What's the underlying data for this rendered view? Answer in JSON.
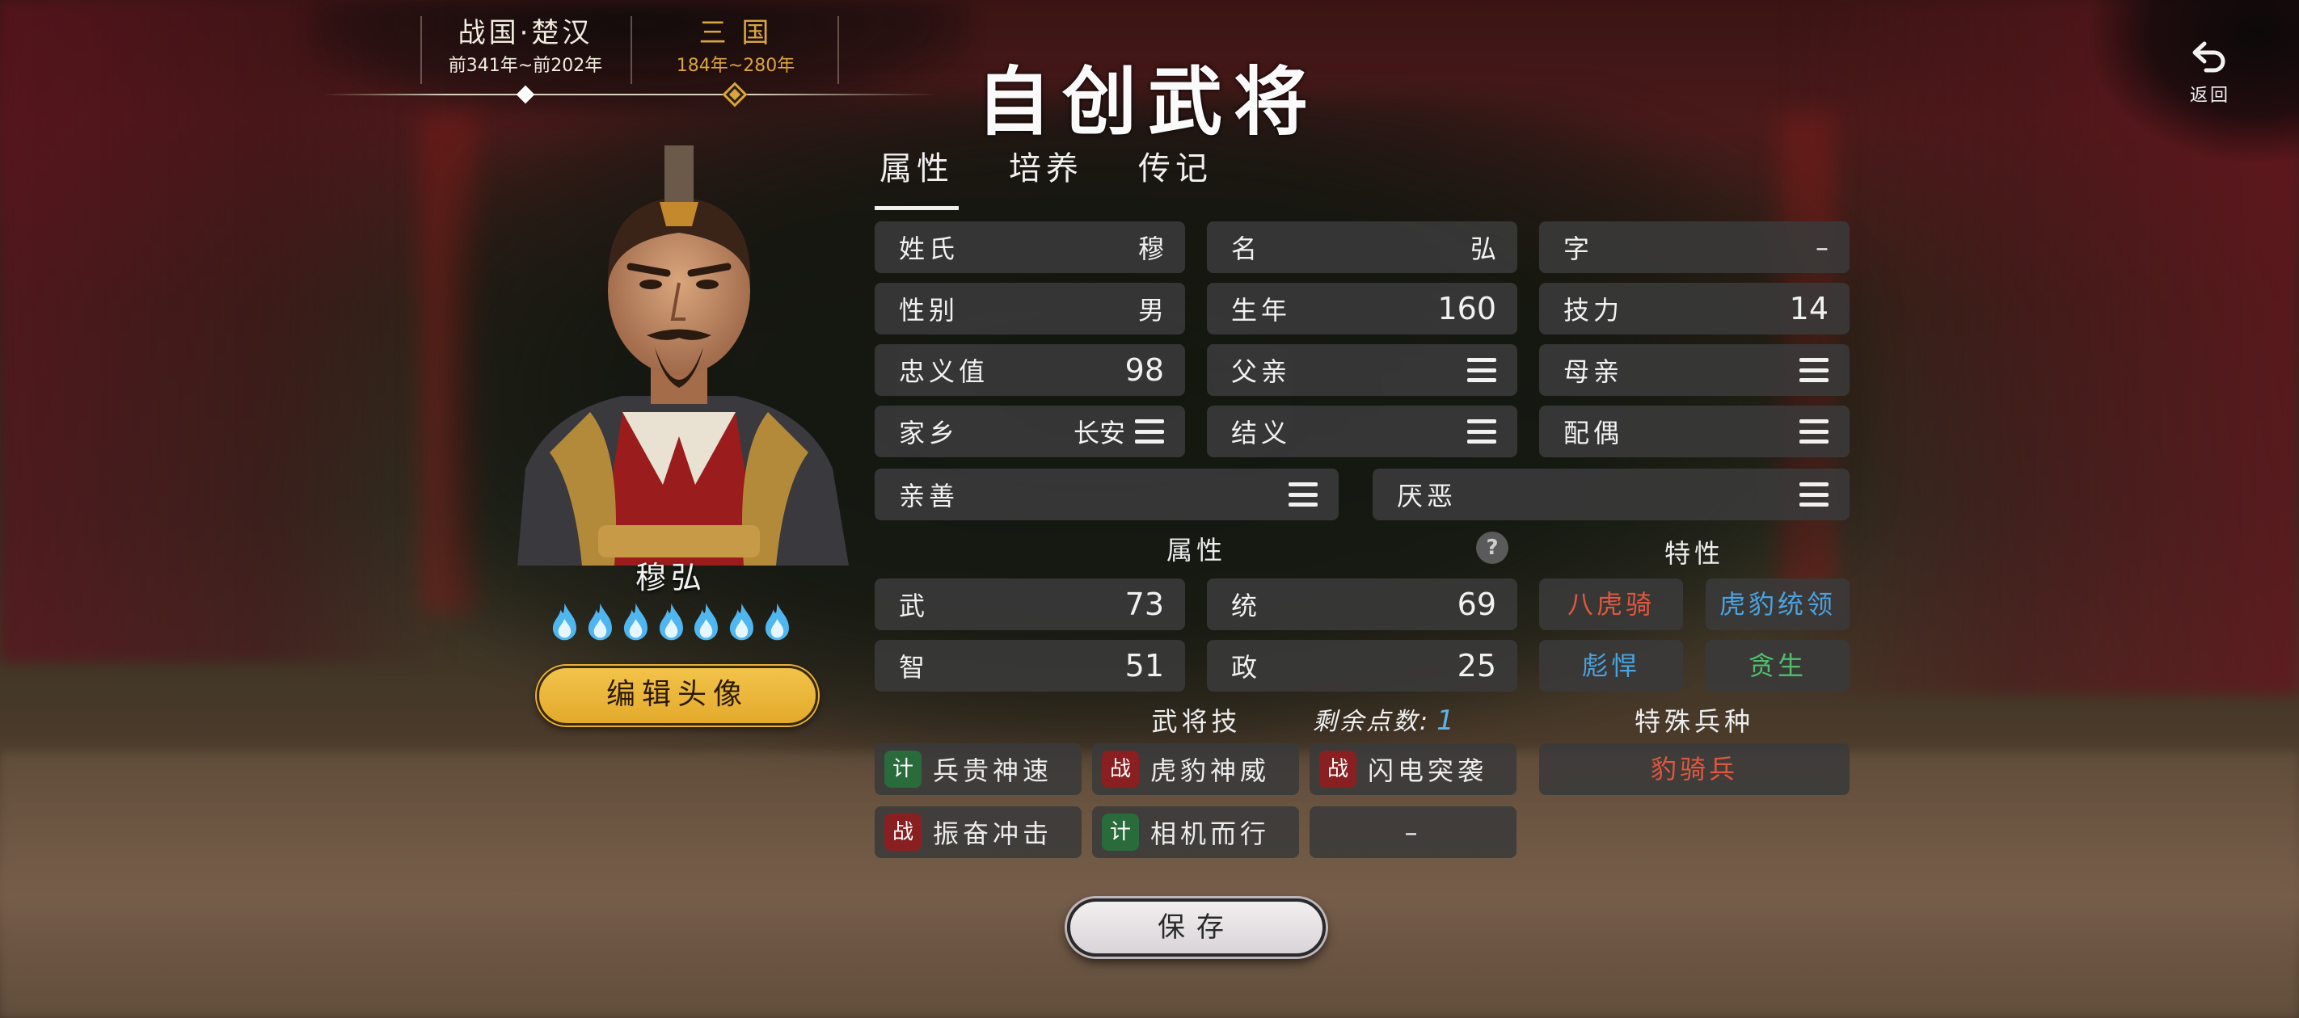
{
  "eras": [
    {
      "name": "战国·楚汉",
      "years": "前341年~前202年",
      "selected": false
    },
    {
      "name": "三 国",
      "years": "184年~280年",
      "selected": true
    }
  ],
  "title": "自创武将",
  "back": {
    "label": "返回",
    "icon": "return-arrow-icon"
  },
  "character": {
    "name": "穆弘",
    "star_count": 7,
    "star_color": "#4fb6f0",
    "edit_avatar_label": "编辑头像"
  },
  "tabs": [
    {
      "label": "属性",
      "active": true
    },
    {
      "label": "培养",
      "active": false
    },
    {
      "label": "传记",
      "active": false
    }
  ],
  "fields": {
    "surname": {
      "label": "姓氏",
      "value": "穆"
    },
    "given_name": {
      "label": "名",
      "value": "弘"
    },
    "courtesy": {
      "label": "字",
      "value": "–"
    },
    "gender": {
      "label": "性别",
      "value": "男"
    },
    "birth_year": {
      "label": "生年",
      "value": "160"
    },
    "skill_power": {
      "label": "技力",
      "value": "14"
    },
    "loyalty": {
      "label": "忠义值",
      "value": "98"
    },
    "father": {
      "label": "父亲"
    },
    "mother": {
      "label": "母亲"
    },
    "hometown": {
      "label": "家乡",
      "value": "长安"
    },
    "sworn": {
      "label": "结义"
    },
    "spouse": {
      "label": "配偶"
    },
    "favor": {
      "label": "亲善"
    },
    "dislike": {
      "label": "厌恶"
    }
  },
  "attributes": {
    "heading": "属性",
    "help": "?",
    "items": [
      {
        "label": "武",
        "value": "73"
      },
      {
        "label": "统",
        "value": "69"
      },
      {
        "label": "智",
        "value": "51"
      },
      {
        "label": "政",
        "value": "25"
      }
    ]
  },
  "traits": {
    "heading": "特性",
    "items": [
      {
        "label": "八虎骑",
        "color": "#e0573f"
      },
      {
        "label": "虎豹统领",
        "color": "#4aa3e0"
      },
      {
        "label": "彪悍",
        "color": "#4aa3e0"
      },
      {
        "label": "贪生",
        "color": "#4fbf6e"
      }
    ]
  },
  "skills": {
    "heading": "武将技",
    "remaining_label": "剩余点数:",
    "remaining_value": "1",
    "items": [
      {
        "badge": "计",
        "type": "ji",
        "label": "兵贵神速"
      },
      {
        "badge": "战",
        "type": "zhan",
        "label": "虎豹神威"
      },
      {
        "badge": "战",
        "type": "zhan",
        "label": "闪电突袭"
      },
      {
        "badge": "战",
        "type": "zhan",
        "label": "振奋冲击"
      },
      {
        "badge": "计",
        "type": "ji",
        "label": "相机而行"
      },
      {
        "label": "–"
      }
    ]
  },
  "special_troop": {
    "heading": "特殊兵种",
    "value": "豹骑兵",
    "color": "#e0573f"
  },
  "save_label": "保存"
}
